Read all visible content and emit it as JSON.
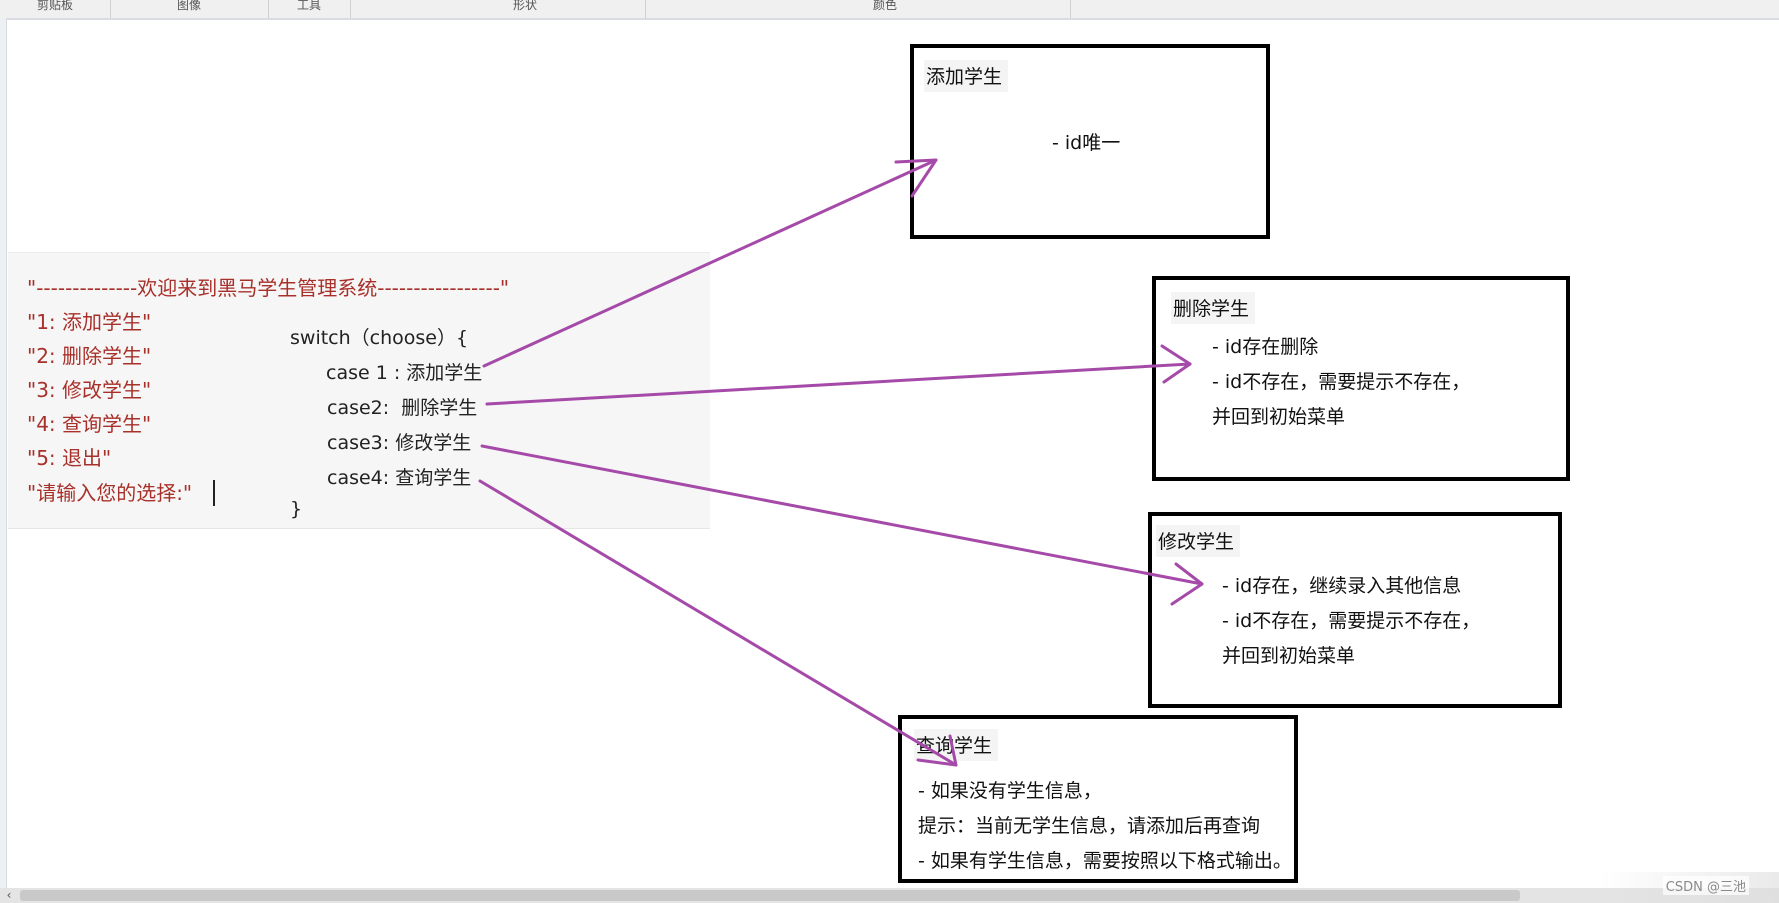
{
  "ribbon": {
    "groups": [
      "剪贴板",
      "图像",
      "工具",
      "形状",
      "颜色"
    ]
  },
  "menu": {
    "lines": [
      "\"--------------欢迎来到黑马学生管理系统-----------------\"",
      "\"1: 添加学生\"",
      "\"2: 删除学生\"",
      "\"3: 修改学生\"",
      "\"4: 查询学生\"",
      "\"5: 退出\"",
      "\"请输入您的选择:\""
    ]
  },
  "switch_block": {
    "header": "switch（choose）{",
    "cases": [
      "case 1 : 添加学生",
      "case2:  删除学生",
      "case3: 修改学生",
      "case4: 查询学生"
    ],
    "close": "}"
  },
  "boxes": {
    "add": {
      "title": "添加学生",
      "lines": [
        "- id唯一"
      ]
    },
    "delete": {
      "title": "删除学生",
      "lines": [
        "- id存在删除",
        "- id不存在，需要提示不存在，",
        "并回到初始菜单"
      ]
    },
    "modify": {
      "title": "修改学生",
      "lines": [
        "- id存在，继续录入其他信息",
        "- id不存在，需要提示不存在，",
        "并回到初始菜单"
      ]
    },
    "query": {
      "title": "查询学生",
      "lines": [
        "- 如果没有学生信息，",
        "提示：当前无学生信息，请添加后再查询",
        "- 如果有学生信息，需要按照以下格式输出。"
      ]
    }
  },
  "arrow_color": "#a54aa8",
  "menu_color": "#a8302a",
  "watermark": "CSDN @三池",
  "icons": {
    "scroll_left": "chevron-left-icon"
  }
}
